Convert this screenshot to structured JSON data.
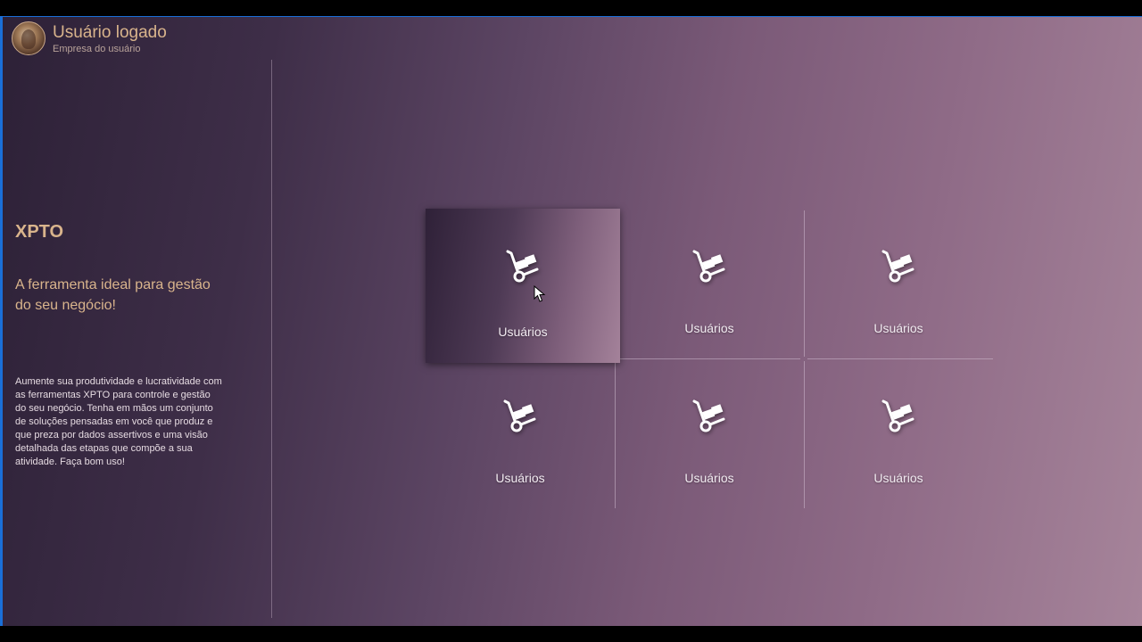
{
  "header": {
    "user_name": "Usuário logado",
    "company": "Empresa do usuário"
  },
  "sidebar": {
    "app_title": "XPTO",
    "tagline": "A ferramenta ideal para gestão do seu negócio!",
    "description": "Aumente sua produtividade e lucratividade com as ferramentas XPTO para controle e gestão do seu negócio. Tenha em mãos um conjunto de soluções pensadas em você que produz e que preza por dados assertivos e uma visão detalhada das etapas que compõe a sua atividade. Faça bom uso!"
  },
  "tiles": [
    {
      "label": "Usuários",
      "icon": "hand-truck-icon",
      "state": "hover"
    },
    {
      "label": "Usuários",
      "icon": "hand-truck-icon",
      "state": "normal"
    },
    {
      "label": "Usuários",
      "icon": "hand-truck-icon",
      "state": "normal"
    },
    {
      "label": "Usuários",
      "icon": "hand-truck-icon",
      "state": "normal"
    },
    {
      "label": "Usuários",
      "icon": "hand-truck-icon",
      "state": "normal"
    },
    {
      "label": "Usuários",
      "icon": "hand-truck-icon",
      "state": "normal"
    }
  ],
  "colors": {
    "accent_text": "#d9b48c",
    "window_border": "#1a6fd8",
    "tile_label": "#f1eaf0"
  }
}
